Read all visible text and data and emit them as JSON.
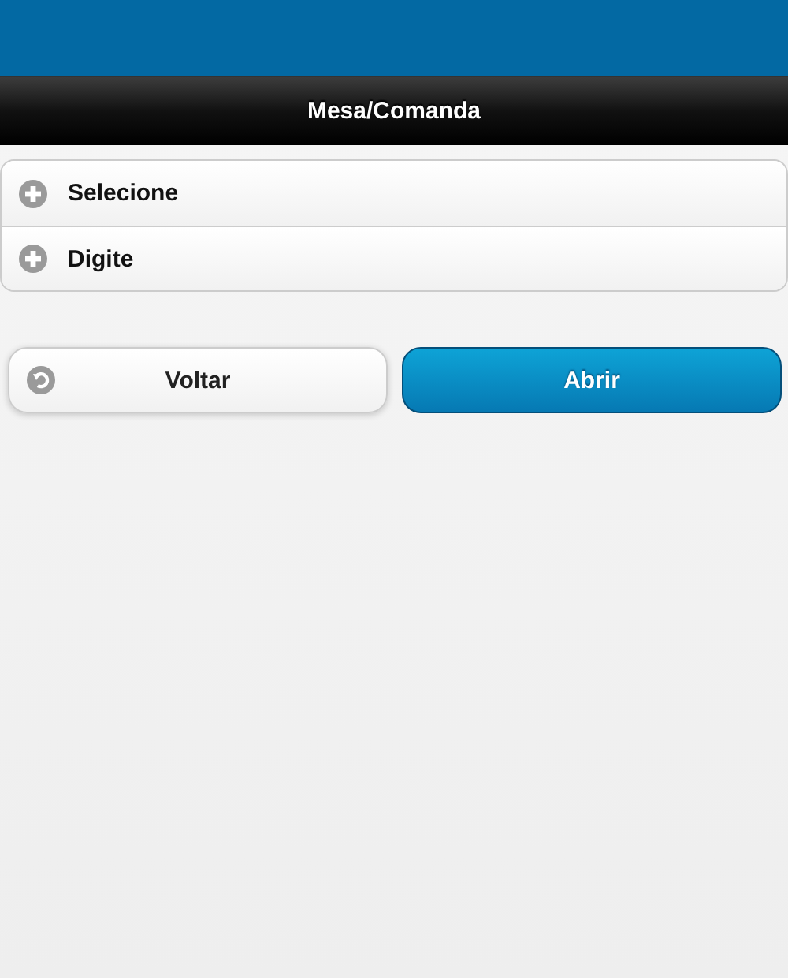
{
  "header": {
    "title": "Mesa/Comanda"
  },
  "sections": [
    {
      "label": "Selecione",
      "expanded": false
    },
    {
      "label": "Digite",
      "expanded": false
    }
  ],
  "buttons": [
    {
      "label": "Voltar",
      "kind": "back"
    },
    {
      "label": "Abrir",
      "kind": "primary"
    }
  ]
}
